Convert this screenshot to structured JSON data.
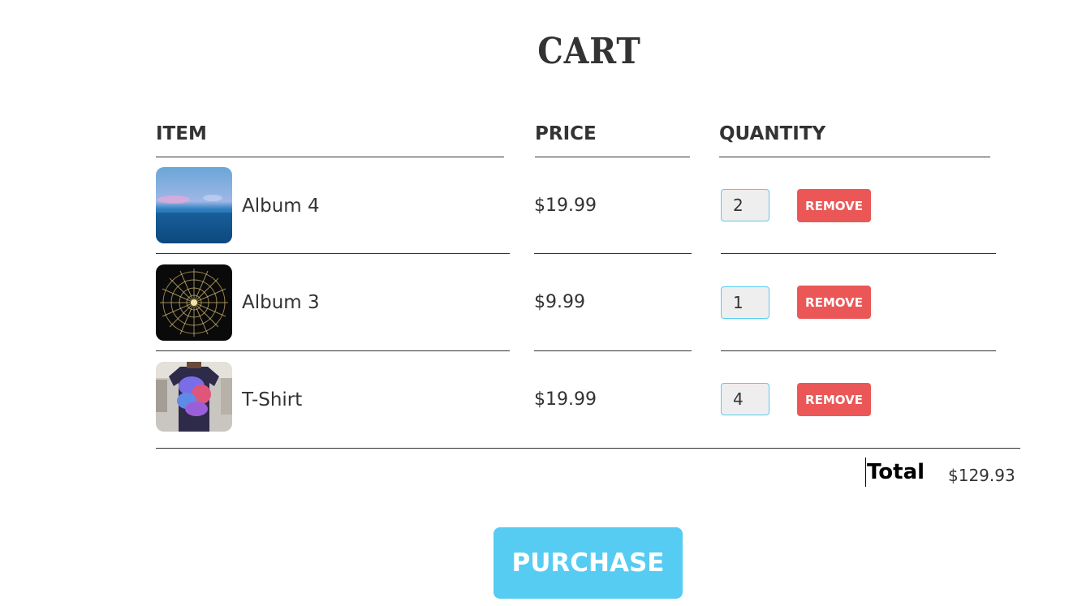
{
  "cart": {
    "title": "CART",
    "headers": {
      "item": "ITEM",
      "price": "PRICE",
      "quantity": "QUANTITY"
    },
    "items": [
      {
        "name": "Album 4",
        "price": "$19.99",
        "quantity": "2",
        "remove_label": "REMOVE"
      },
      {
        "name": "Album 3",
        "price": "$9.99",
        "quantity": "1",
        "remove_label": "REMOVE"
      },
      {
        "name": "T-Shirt",
        "price": "$19.99",
        "quantity": "4",
        "remove_label": "REMOVE"
      }
    ],
    "total_label": "Total",
    "total_value": "$129.93",
    "purchase_label": "PURCHASE"
  },
  "colors": {
    "accent": "#56ccf2",
    "danger": "#eb5757",
    "text": "#333333"
  }
}
